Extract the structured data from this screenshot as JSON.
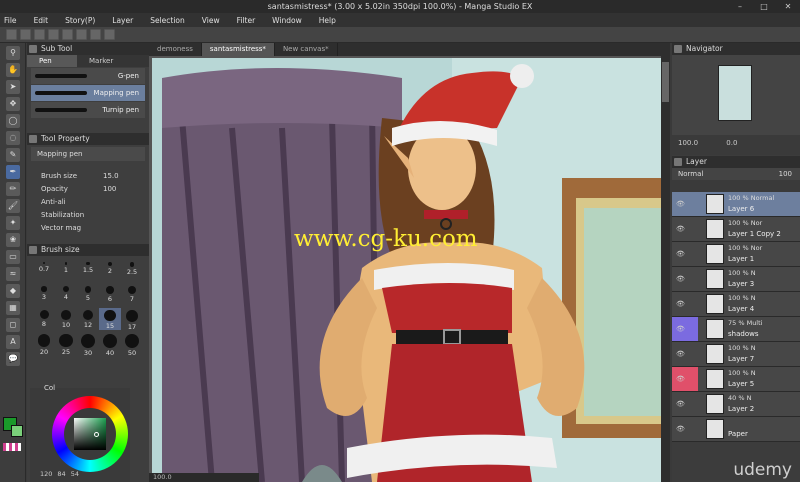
{
  "window": {
    "title": "santasmistress* (3.00 x 5.02in 350dpi 100.0%) - Manga Studio EX",
    "controls": [
      "–",
      "□",
      "✕"
    ]
  },
  "menu": [
    "File",
    "Edit",
    "Story(P)",
    "Layer",
    "Selection",
    "View",
    "Filter",
    "Window",
    "Help"
  ],
  "sub_tool": {
    "title": "Sub Tool",
    "tabs": [
      "Pen",
      "Marker"
    ],
    "brushes": [
      "G-pen",
      "Mapping pen",
      "Turnip pen"
    ]
  },
  "tool_property": {
    "title": "Tool Property",
    "current": "Mapping pen",
    "brush_size_label": "Brush size",
    "brush_size_value": "15.0",
    "opacity_label": "Opacity",
    "opacity_value": "100",
    "antialias_label": "Anti-ali",
    "stabilization_label": "Stabilization",
    "vector_label": "Vector mag"
  },
  "brush_size": {
    "title": "Brush size",
    "sizes": [
      "0.7",
      "1",
      "1.5",
      "2",
      "2.5",
      "3",
      "4",
      "5",
      "6",
      "7",
      "8",
      "10",
      "12",
      "15",
      "17",
      "20",
      "25",
      "30",
      "40",
      "50"
    ]
  },
  "color_panel": {
    "title": "Col",
    "readout": [
      "120",
      "84",
      "54"
    ]
  },
  "document_tabs": [
    "demoness",
    "santasmistress*",
    "New canvas*"
  ],
  "canvas": {
    "watermark": "www.cg-ku.com"
  },
  "status": {
    "zoom": "100.0"
  },
  "navigator": {
    "title": "Navigator",
    "zoom": "100.0",
    "angle": "0.0"
  },
  "layer_panel": {
    "title": "Layer",
    "blend_mode": "Normal",
    "opacity": "100",
    "layers": [
      {
        "mode": "100 %  Normal",
        "name": "Layer 6",
        "selected": true,
        "swatch": ""
      },
      {
        "mode": "100 %  Nor",
        "name": "Layer 1 Copy 2",
        "selected": false,
        "swatch": ""
      },
      {
        "mode": "100 %  Nor",
        "name": "Layer 1",
        "selected": false,
        "swatch": ""
      },
      {
        "mode": "100 %  N",
        "name": "Layer 3",
        "selected": false,
        "swatch": ""
      },
      {
        "mode": "100 %  N",
        "name": "Layer 4",
        "selected": false,
        "swatch": ""
      },
      {
        "mode": "75 %  Multi",
        "name": "shadows",
        "selected": false,
        "swatch": "#7b6be0"
      },
      {
        "mode": "100 %  N",
        "name": "Layer 7",
        "selected": false,
        "swatch": ""
      },
      {
        "mode": "100 %  N",
        "name": "Layer 5",
        "selected": false,
        "swatch": "#e0506a"
      },
      {
        "mode": "40 %  N",
        "name": "Layer 2",
        "selected": false,
        "swatch": ""
      },
      {
        "mode": "",
        "name": "Paper",
        "selected": false,
        "swatch": ""
      }
    ]
  },
  "brand": "udemy",
  "colors": {
    "main": "#1a9a2a",
    "sub": "#7ad07a",
    "accent": "#6b7f9e"
  }
}
